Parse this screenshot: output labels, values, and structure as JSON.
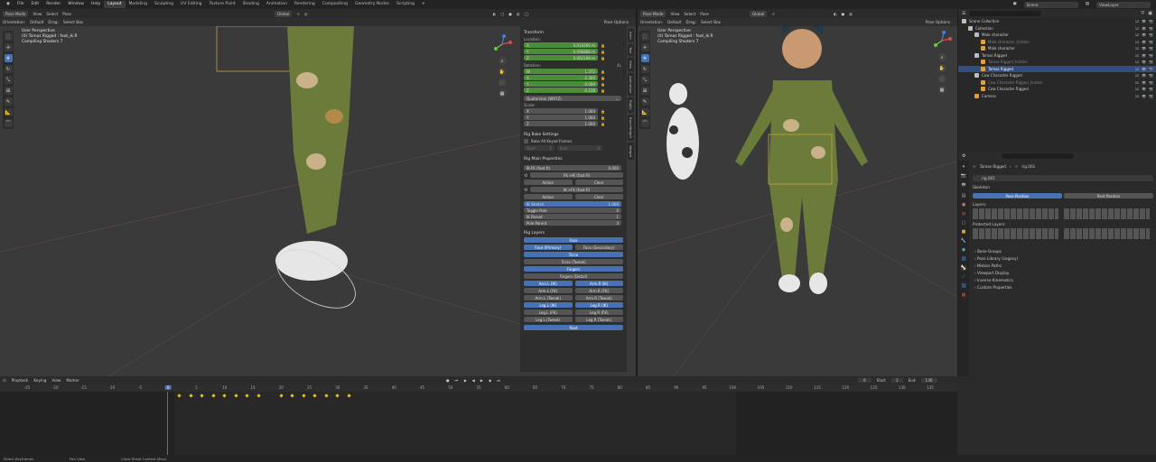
{
  "topbar": {
    "menus": [
      "File",
      "Edit",
      "Render",
      "Window",
      "Help"
    ],
    "workspaces": [
      "Layout",
      "Modeling",
      "Sculpting",
      "UV Editing",
      "Texture Paint",
      "Shading",
      "Animation",
      "Rendering",
      "Compositing",
      "Geometry Nodes",
      "Scripting"
    ],
    "scene": "Scene",
    "view_layer": "ViewLayer"
  },
  "viewport_left": {
    "mode": "Pose Mode",
    "menus": [
      "View",
      "Select",
      "Pose"
    ],
    "orientation_label": "Orientation:",
    "orientation_value": "Default",
    "drag_label": "Drag:",
    "drag_value": "Select Box",
    "transform_space": "Global",
    "pose_options": "Pose Options",
    "overlay": [
      "User Perspective",
      "(0) Tomas Rigged : foot_ik.R",
      "Compiling Shaders 7"
    ]
  },
  "viewport_right": {
    "mode": "Pose Mode",
    "menus": [
      "View",
      "Select",
      "Pose"
    ],
    "orientation_label": "Orientation:",
    "orientation_value": "Default",
    "drag_label": "Drag:",
    "drag_value": "Select Box",
    "transform_space": "Global",
    "pose_options": "Pose Options",
    "overlay": [
      "User Perspective",
      "(0) Tomas Rigged : foot_ik.R",
      "Compiling Shaders 7"
    ]
  },
  "npanel": {
    "transform_title": "Transform",
    "location_label": "Location:",
    "location": [
      {
        "axis": "X",
        "value": "0.014369 m"
      },
      {
        "axis": "Y",
        "value": "-0.096868 m"
      },
      {
        "axis": "Z",
        "value": "0.062109 m"
      }
    ],
    "rotation_label": "Rotation:",
    "rotation_mode_tag": "4L",
    "rotation": [
      {
        "axis": "W",
        "value": "1.372"
      },
      {
        "axis": "X",
        "value": "0.300"
      },
      {
        "axis": "Y",
        "value": "0.000"
      },
      {
        "axis": "Z",
        "value": "-0.238"
      }
    ],
    "rotation_mode": "Quaternion (WXYZ)",
    "scale_label": "Scale:",
    "scale": [
      {
        "axis": "X",
        "value": "1.000"
      },
      {
        "axis": "Y",
        "value": "1.000"
      },
      {
        "axis": "Z",
        "value": "1.000"
      }
    ],
    "rig_bake_title": "Rig Bake Settings",
    "bake_all": "Bake All Keyed Frames",
    "bake_start": "Start",
    "bake_start_val": "1",
    "bake_end": "End",
    "bake_end_val": "0",
    "rig_main_title": "Rig Main Properties",
    "ik_fk_label": "IK-FK (foot.R)",
    "ik_fk_value": "0.000",
    "fk_ik_label": "FK->IK (foot.R)",
    "ik_fk2_label": "IK->FK (foot.R)",
    "action_label": "Action",
    "clear_label": "Clear",
    "ik_stretch_label": "IK Stretch",
    "ik_stretch_value": "1.000",
    "toggle_pole_label": "Toggle Pole",
    "toggle_pole_value": "0",
    "ik_parent_label": "IK Parent",
    "ik_parent_value": "1",
    "pole_parent_label": "Pole Parent",
    "pole_parent_value": "3",
    "rig_layers_title": "Rig Layers",
    "layers": {
      "face": "Face",
      "face_primary": "Face (Primary)",
      "face_secondary": "Face (Secondary)",
      "torso": "Torso",
      "torso_tweak": "Torso (Tweak)",
      "fingers": "Fingers",
      "fingers_detail": "Fingers (Detail)",
      "arm_l_ik": "Arm.L (IK)",
      "arm_r_ik": "Arm.R (IK)",
      "arm_l_fk": "Arm.L (FK)",
      "arm_r_fk": "Arm.R (FK)",
      "arm_l_tweak": "Arm.L (Tweak)",
      "arm_r_tweak": "Arm.R (Tweak)",
      "leg_l_ik": "Leg.L (IK)",
      "leg_r_ik": "Leg.R (IK)",
      "leg_l_fk": "Leg.L (FK)",
      "leg_r_fk": "Leg.R (FK)",
      "leg_l_tweak": "Leg.L (Tweak)",
      "leg_r_tweak": "Leg.R (Tweak)",
      "root": "Root"
    },
    "tabs": [
      "Item",
      "Tool",
      "View",
      "Animation",
      "Rigify",
      "BoneWidget",
      "Weight"
    ]
  },
  "outliner": {
    "rows": [
      {
        "label": "Scene Collection",
        "indent": 0,
        "color": "#bdbdbd",
        "dim": false,
        "sel": false
      },
      {
        "label": "Collection",
        "indent": 1,
        "color": "#bdbdbd",
        "dim": false,
        "sel": false
      },
      {
        "label": "Male character",
        "indent": 2,
        "color": "#bdbdbd",
        "dim": false,
        "sel": false
      },
      {
        "label": "Male character_hidden",
        "indent": 3,
        "color": "#e0a040",
        "dim": true,
        "sel": false
      },
      {
        "label": "Male character",
        "indent": 3,
        "color": "#e0a040",
        "dim": false,
        "sel": false
      },
      {
        "label": "Tomas Rigged",
        "indent": 2,
        "color": "#bdbdbd",
        "dim": false,
        "sel": false
      },
      {
        "label": "Tomas Rigged_hidden",
        "indent": 3,
        "color": "#e0a040",
        "dim": true,
        "sel": false
      },
      {
        "label": "Tomas Rigged",
        "indent": 3,
        "color": "#e0a040",
        "dim": false,
        "sel": true
      },
      {
        "label": "Cow Character Rigged",
        "indent": 2,
        "color": "#bdbdbd",
        "dim": false,
        "sel": false
      },
      {
        "label": "Cow Character Rigged_hidden",
        "indent": 3,
        "color": "#e0a040",
        "dim": true,
        "sel": false
      },
      {
        "label": "Cow Character Rigged",
        "indent": 3,
        "color": "#e0a040",
        "dim": false,
        "sel": false
      },
      {
        "label": "Camera",
        "indent": 2,
        "color": "#e0a040",
        "dim": false,
        "sel": false
      }
    ]
  },
  "properties": {
    "object": "Tomas Rigged",
    "data": "rig.001",
    "data_field": "rig.001",
    "skeleton_title": "Skeleton",
    "pose_position": "Pose Position",
    "rest_position": "Rest Position",
    "layers_label": "Layers:",
    "protected_layers_label": "Protected Layers:",
    "sections": [
      "Bone Groups",
      "Pose Library (Legacy)",
      "Motion Paths",
      "Viewport Display",
      "Inverse Kinematics",
      "Custom Properties"
    ]
  },
  "timeline": {
    "menus": [
      "Playback",
      "Keying",
      "View",
      "Marker"
    ],
    "current_frame": "0",
    "start_label": "Start",
    "start_value": "1",
    "end_label": "End",
    "end_value": "130",
    "ticks": [
      "-25",
      "-20",
      "-15",
      "-10",
      "-5",
      "0",
      "5",
      "10",
      "15",
      "20",
      "25",
      "30",
      "35",
      "40",
      "45",
      "50",
      "55",
      "60",
      "65",
      "70",
      "75",
      "80",
      "85",
      "90",
      "95",
      "100",
      "105",
      "110",
      "115",
      "120",
      "125",
      "130",
      "135"
    ]
  },
  "statusbar": [
    "Select Keyframes",
    "Pan View",
    "Close Sheet Context Menu"
  ]
}
